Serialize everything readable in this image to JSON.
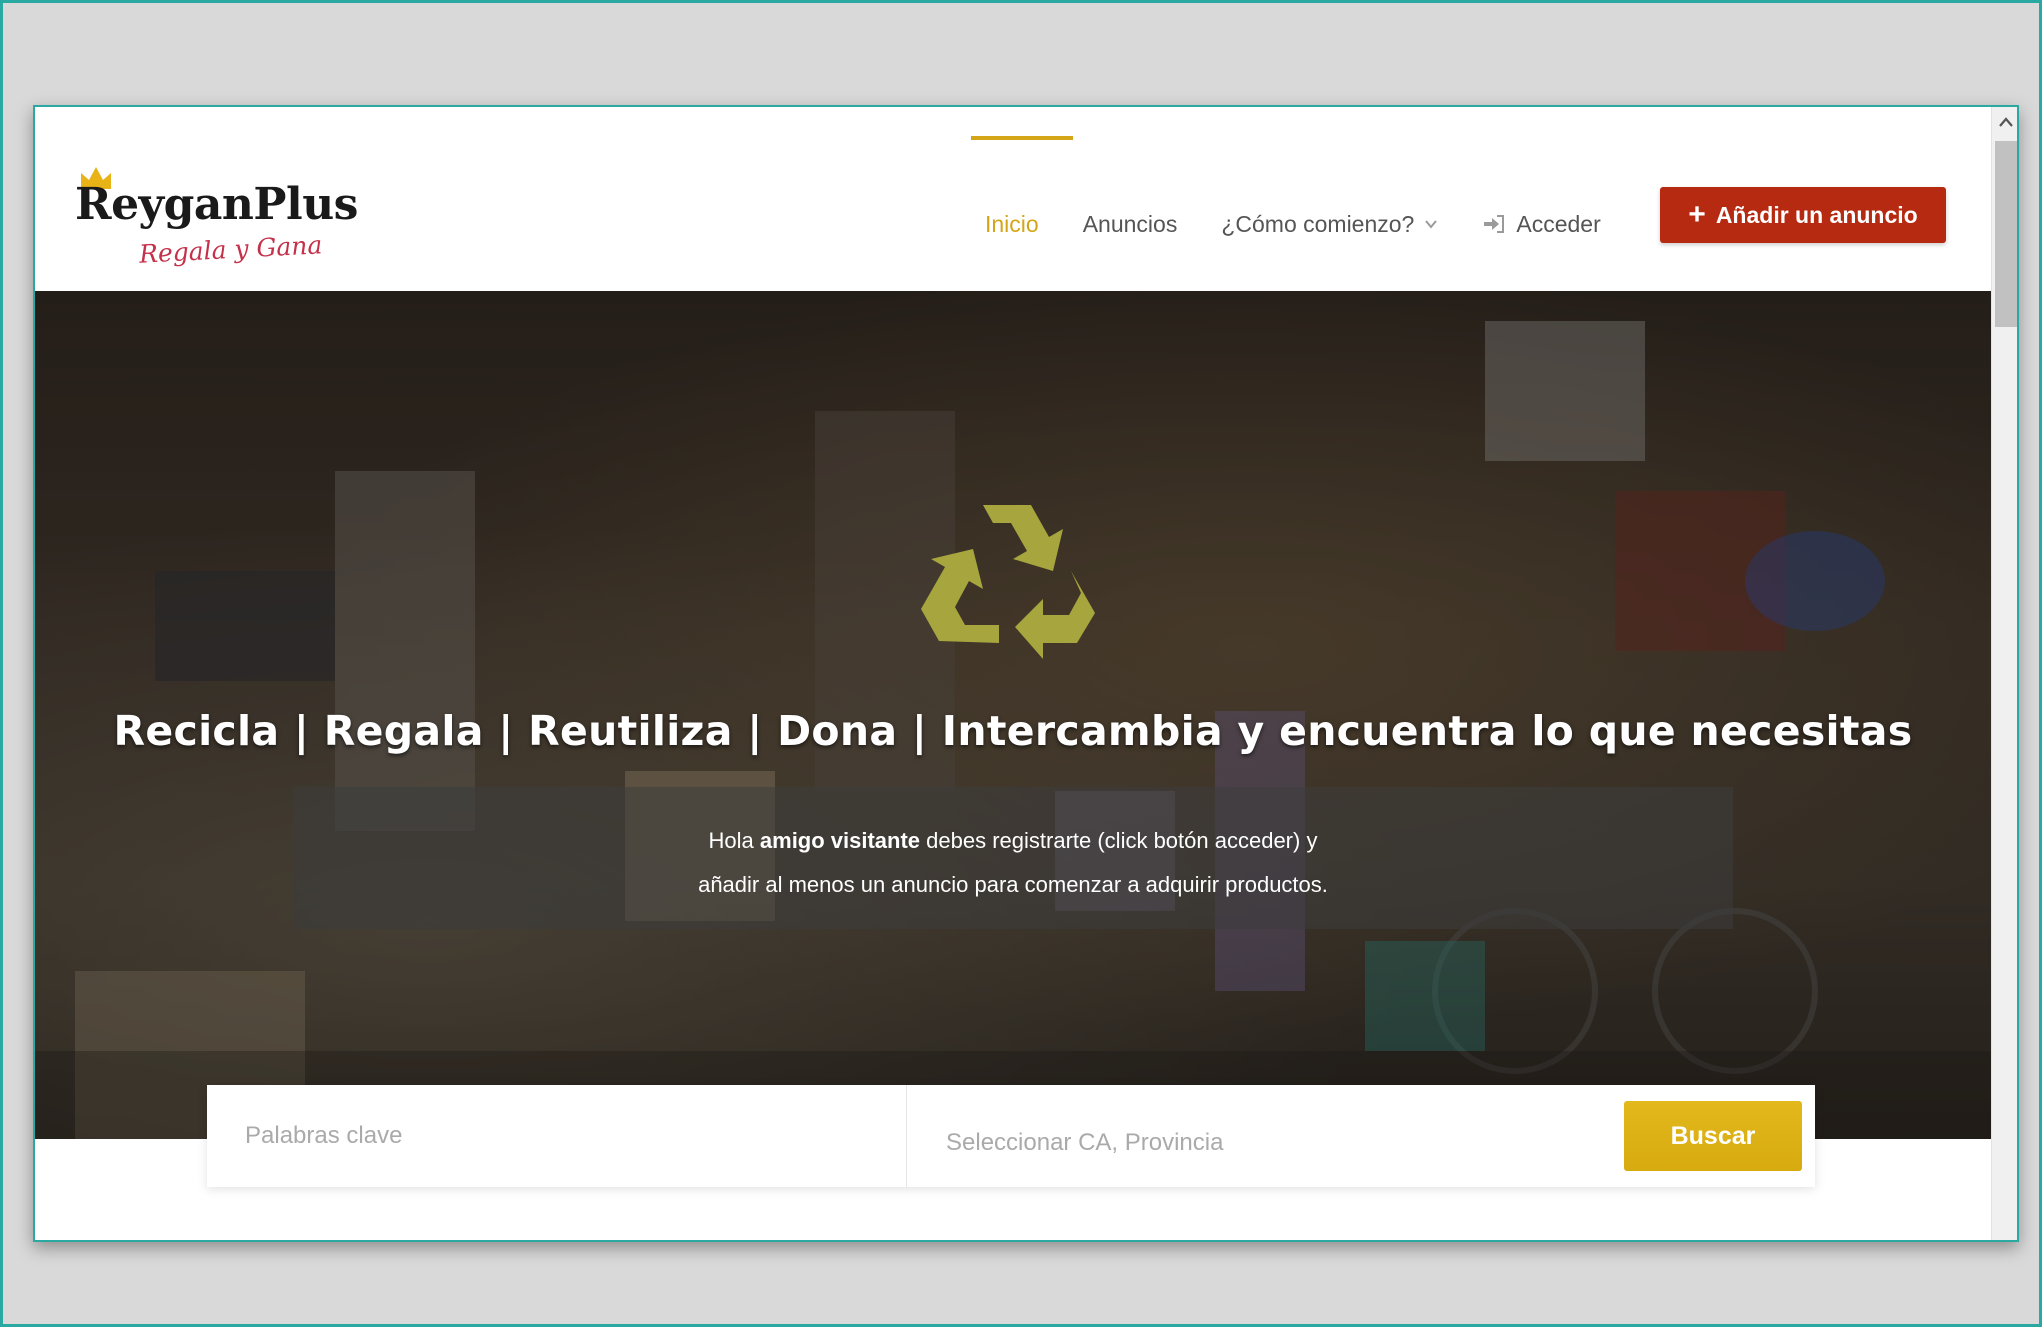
{
  "site": {
    "logo_name": "ReyganPlus",
    "logo_tagline": "Regala y Gana"
  },
  "nav": {
    "items": [
      {
        "label": "Inicio",
        "active": true
      },
      {
        "label": "Anuncios"
      },
      {
        "label": "¿Cómo comienzo?",
        "has_dropdown": true
      },
      {
        "label": "Acceder",
        "icon": "login-icon"
      }
    ],
    "add_button": "Añadir un anuncio"
  },
  "hero": {
    "title": "Recicla | Regala | Reutiliza | Dona | Intercambia y encuentra lo que necesitas",
    "notice_line1_pre": "Hola ",
    "notice_line1_bold": "amigo visitante",
    "notice_line1_post": " debes registrarte (click botón acceder) y",
    "notice_line2": "añadir al menos un anuncio para comenzar a adquirir productos.",
    "icon": "recycle-icon"
  },
  "search": {
    "keywords_placeholder": "Palabras clave",
    "location_placeholder": "Seleccionar CA, Provincia",
    "button": "Buscar"
  },
  "colors": {
    "accent": "#d4a617",
    "add_button": "#b62a12",
    "search_button": "#ddb216",
    "frame": "#2aa8a2"
  }
}
